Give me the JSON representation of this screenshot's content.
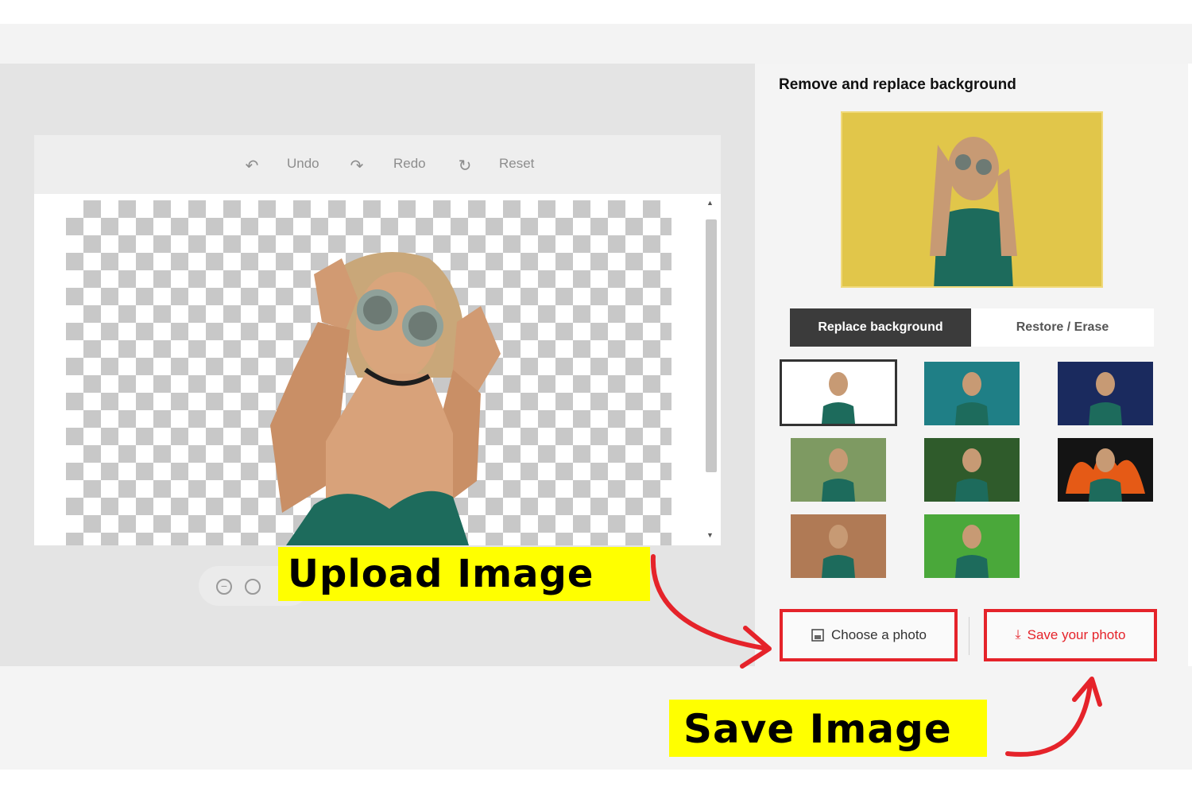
{
  "toolbar": {
    "undo_label": "Undo",
    "redo_label": "Redo",
    "reset_label": "Reset",
    "undo_icon": "undo-icon",
    "redo_icon": "redo-icon",
    "reset_icon": "reset-icon"
  },
  "zoom": {
    "out_icon": "zoom-out-icon",
    "reset_icon": "zoom-reset-icon"
  },
  "callouts": {
    "upload": "Upload Image",
    "save": "Save Image"
  },
  "panel": {
    "title": "Remove and replace background",
    "tabs": [
      {
        "label": "Replace background",
        "active": true
      },
      {
        "label": "Restore / Erase",
        "active": false
      }
    ],
    "backgrounds": [
      {
        "name": "white",
        "selected": true
      },
      {
        "name": "teal-bokeh"
      },
      {
        "name": "night-sky"
      },
      {
        "name": "palm-leaves"
      },
      {
        "name": "jungle-leaves"
      },
      {
        "name": "fire"
      },
      {
        "name": "brick-wall"
      },
      {
        "name": "green-grass"
      }
    ],
    "choose_label": "Choose a photo",
    "save_label": "Save your photo"
  },
  "colors": {
    "accent_red": "#e5232a",
    "callout_yellow": "#ffff00",
    "tab_active": "#3b3b3b"
  }
}
